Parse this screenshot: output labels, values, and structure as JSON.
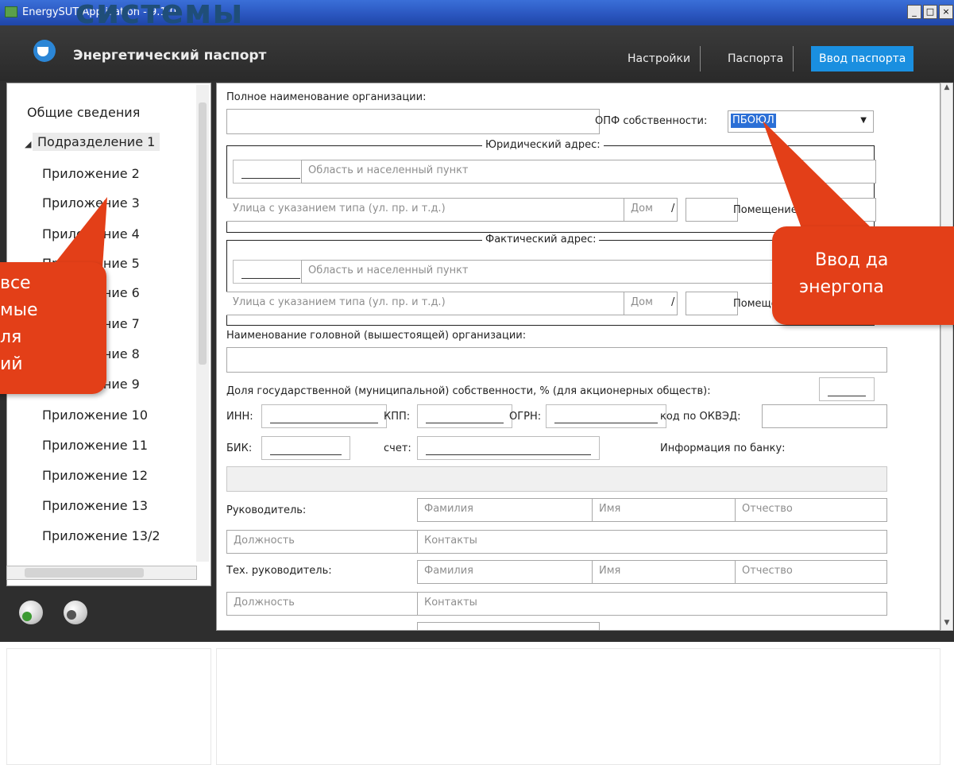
{
  "window": {
    "title": "EnergySUT Application - 9.1.0",
    "controls": [
      "_",
      "□",
      "×"
    ]
  },
  "overlay_heading": "системы",
  "header": {
    "app_title": "Энергетический паспорт",
    "nav": [
      "Настройки",
      "Паспорта",
      "Ввод паспорта"
    ]
  },
  "sidebar": {
    "items": [
      "Общие сведения",
      "Подразделение 1",
      "Приложение 2",
      "Приложение 3",
      "Приложение 4",
      "Приложение 5",
      "Приложение 6",
      "Приложение 7",
      "Приложение 8",
      "Приложение 9",
      "Приложение 10",
      "Приложение 11",
      "Приложение 12",
      "Приложение 13",
      "Приложение 13/2"
    ]
  },
  "form": {
    "org_full_name_label": "Полное наименование организации:",
    "opf_label": "ОПФ собственности:",
    "opf_value": "ПБОЮЛ",
    "legal_address": {
      "title": "Юридический адрес:",
      "region_placeholder": "Область и населенный пункт",
      "street_placeholder": "Улица с указанием типа (ул. пр. и т.д.)",
      "house_placeholder": "Дом",
      "slash": "/",
      "room_label": "Помещение:"
    },
    "actual_address": {
      "title": "Фактический адрес:",
      "region_placeholder": "Область и населенный пункт",
      "street_placeholder": "Улица с указанием типа (ул. пр. и т.д.)",
      "house_placeholder": "Дом",
      "slash": "/",
      "room_label": "Помещение:"
    },
    "parent_org_label": "Наименование головной (вышестоящей) организации:",
    "state_share_label": "Доля государственной (муниципальной) собственности, % (для акционерных обществ):",
    "inn_label": "ИНН:",
    "kpp_label": "КПП:",
    "ogrn_label": "ОГРН:",
    "okved_label": "код по ОКВЭД:",
    "bik_label": "БИК:",
    "account_label": "счет:",
    "bank_info_label": "Информация по банку:",
    "head_label": "Руководитель:",
    "tech_head_label": "Тех. руководитель:",
    "surname_placeholder": "Фамилия",
    "name_placeholder": "Имя",
    "patronymic_placeholder": "Отчество",
    "position_placeholder": "Должность",
    "contacts_placeholder": "Контакты"
  },
  "callouts": {
    "left": [
      "все",
      "мые",
      "ля",
      "ий"
    ],
    "right": [
      "Ввод да",
      "энергопа"
    ]
  }
}
